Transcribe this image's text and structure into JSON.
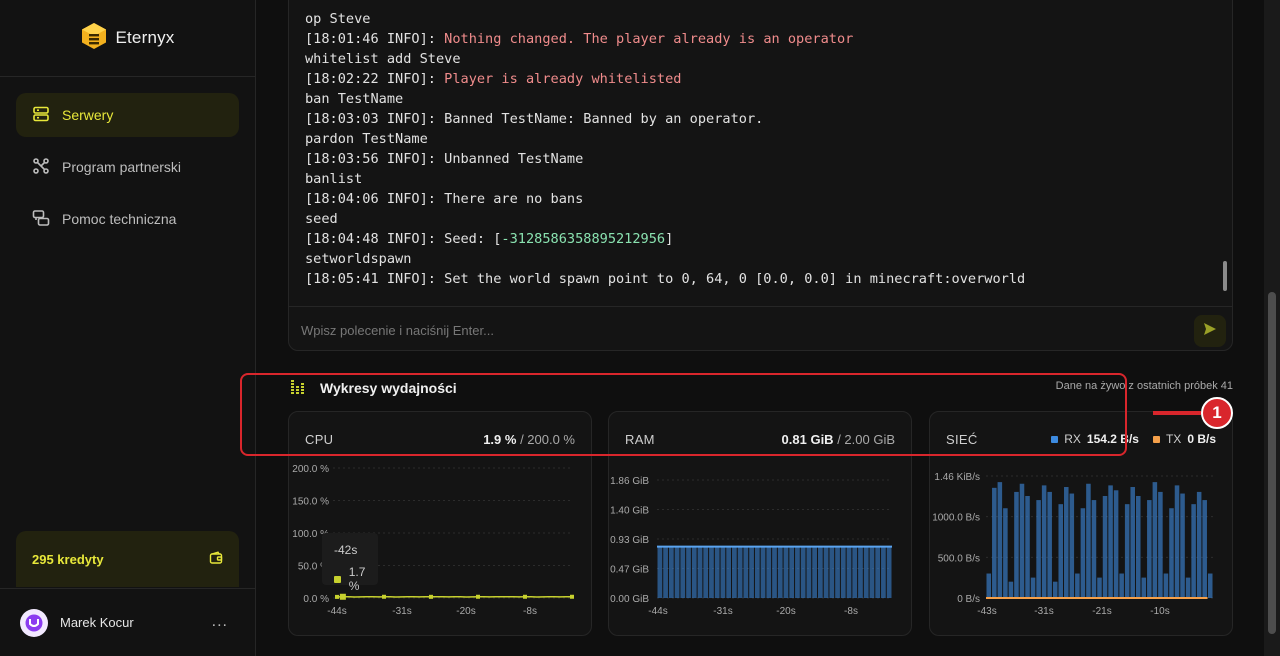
{
  "app": {
    "name": "Eternyx"
  },
  "sidebar": {
    "items": [
      {
        "label": "Serwery",
        "icon": "server-icon",
        "active": true
      },
      {
        "label": "Program partnerski",
        "icon": "affiliate-icon",
        "active": false
      },
      {
        "label": "Pomoc techniczna",
        "icon": "support-icon",
        "active": false
      }
    ],
    "credits": {
      "label": "295 kredyty",
      "icon": "wallet-icon"
    },
    "user": {
      "name": "Marek Kocur",
      "menu": "..."
    }
  },
  "console": {
    "lines": [
      {
        "text": "op Steve",
        "type": "cmd"
      },
      {
        "prefix": "[18:01:46 INFO]: ",
        "text": "Nothing changed. The player already is an operator",
        "type": "warn"
      },
      {
        "text": "whitelist add Steve",
        "type": "cmd"
      },
      {
        "prefix": "[18:02:22 INFO]: ",
        "text": "Player is already whitelisted",
        "type": "warn"
      },
      {
        "text": "ban TestName",
        "type": "cmd"
      },
      {
        "text": "[18:03:03 INFO]: Banned TestName: Banned by an operator.",
        "type": "info"
      },
      {
        "text": "pardon TestName",
        "type": "cmd"
      },
      {
        "text": "[18:03:56 INFO]: Unbanned TestName",
        "type": "info"
      },
      {
        "text": "banlist",
        "type": "cmd"
      },
      {
        "text": "[18:04:06 INFO]: There are no bans",
        "type": "info"
      },
      {
        "text": "seed",
        "type": "cmd"
      },
      {
        "prefix": "[18:04:48 INFO]: Seed: [",
        "text": "-3128586358895212956",
        "suffix": "]",
        "type": "seed"
      },
      {
        "text": "setworldspawn",
        "type": "cmd"
      },
      {
        "text": "[18:05:41 INFO]: Set the world spawn point to 0, 64, 0 [0.0, 0.0] in minecraft:overworld",
        "type": "info"
      }
    ],
    "input_placeholder": "Wpisz polecenie i naciśnij Enter...",
    "send_icon": "send-icon"
  },
  "performance": {
    "title": "Wykresy wydajności",
    "note": "Dane na żywo z ostatnich próbek 41",
    "icon": "equalizer-icon"
  },
  "cards": {
    "cpu": {
      "label": "CPU",
      "value": "1.9 %",
      "max": " / 200.0 %"
    },
    "ram": {
      "label": "RAM",
      "value": "0.81 GiB",
      "max": " / 2.00 GiB"
    },
    "net": {
      "label": "SIEĆ",
      "rx_label": "RX",
      "rx_value": "154.2 B/s",
      "tx_label": "TX",
      "tx_value": "0 B/s"
    }
  },
  "tooltip": {
    "time": "-42s",
    "value": "1.7 %"
  },
  "annotation": {
    "badge": "1"
  },
  "colors": {
    "accent": "#e8e83a",
    "cpu": "#c7d12e",
    "ram": "#3d8be0",
    "rx": "#3d8be0",
    "tx": "#f5a04a",
    "annotation": "#d9262c"
  },
  "chart_data": [
    {
      "type": "line",
      "name": "CPU",
      "x": [
        "-44s",
        "-31s",
        "-20s",
        "-8s"
      ],
      "yticks": [
        "200.0 %",
        "150.0 %",
        "100.0 %",
        "50.0 %",
        "0.0 %"
      ],
      "ylim": [
        0,
        200
      ],
      "values": [
        1.7,
        1.9,
        1.8,
        1.6,
        1.7,
        1.9,
        1.8,
        1.7,
        1.9,
        1.8,
        1.6,
        1.7,
        1.9,
        1.8,
        1.7,
        1.9,
        1.8,
        1.9,
        1.8,
        1.7,
        1.9,
        1.8,
        1.6,
        1.7,
        1.9,
        1.8,
        1.7,
        1.9,
        1.8,
        1.9,
        1.8,
        1.7,
        1.9,
        1.8,
        1.6,
        1.7,
        1.9,
        1.8,
        1.7,
        1.9,
        1.9
      ]
    },
    {
      "type": "area",
      "name": "RAM",
      "x": [
        "-44s",
        "-31s",
        "-20s",
        "-8s"
      ],
      "yticks": [
        "1.86 GiB",
        "1.40 GiB",
        "0.93 GiB",
        "0.47 GiB",
        "0.00 GiB"
      ],
      "ylim": [
        0,
        1.86
      ],
      "values": [
        0.81,
        0.81,
        0.81,
        0.81,
        0.81,
        0.81,
        0.81,
        0.81,
        0.81,
        0.81,
        0.81,
        0.81,
        0.81,
        0.81,
        0.81,
        0.81,
        0.81,
        0.81,
        0.81,
        0.81,
        0.81,
        0.81,
        0.81,
        0.81,
        0.81,
        0.81,
        0.81,
        0.81,
        0.81,
        0.81,
        0.81,
        0.81,
        0.81,
        0.81,
        0.81,
        0.81,
        0.81,
        0.81,
        0.81,
        0.81,
        0.81
      ]
    },
    {
      "type": "area",
      "name": "SIEĆ",
      "x": [
        "-43s",
        "-31s",
        "-21s",
        "-10s"
      ],
      "yticks": [
        "1.46 KiB/s",
        "1000.0 B/s",
        "500.0 B/s",
        "0 B/s"
      ],
      "ylim": [
        0,
        1495
      ],
      "series": [
        {
          "name": "RX",
          "values": [
            300,
            1350,
            1420,
            1100,
            200,
            1300,
            1400,
            1250,
            250,
            1200,
            1380,
            1300,
            200,
            1150,
            1360,
            1280,
            300,
            1100,
            1400,
            1200,
            250,
            1250,
            1380,
            1320,
            300,
            1150,
            1360,
            1250,
            250,
            1200,
            1420,
            1300,
            300,
            1100,
            1380,
            1280,
            250,
            1150,
            1300,
            1200,
            300
          ]
        },
        {
          "name": "TX",
          "values": [
            0,
            0,
            0,
            0,
            0,
            0,
            0,
            0,
            0,
            0,
            0,
            0,
            0,
            0,
            0,
            0,
            0,
            0,
            0,
            0,
            0,
            0,
            0,
            0,
            0,
            0,
            0,
            0,
            0,
            0,
            0,
            0,
            0,
            0,
            0,
            0,
            0,
            0,
            0,
            0,
            0
          ]
        }
      ]
    }
  ]
}
